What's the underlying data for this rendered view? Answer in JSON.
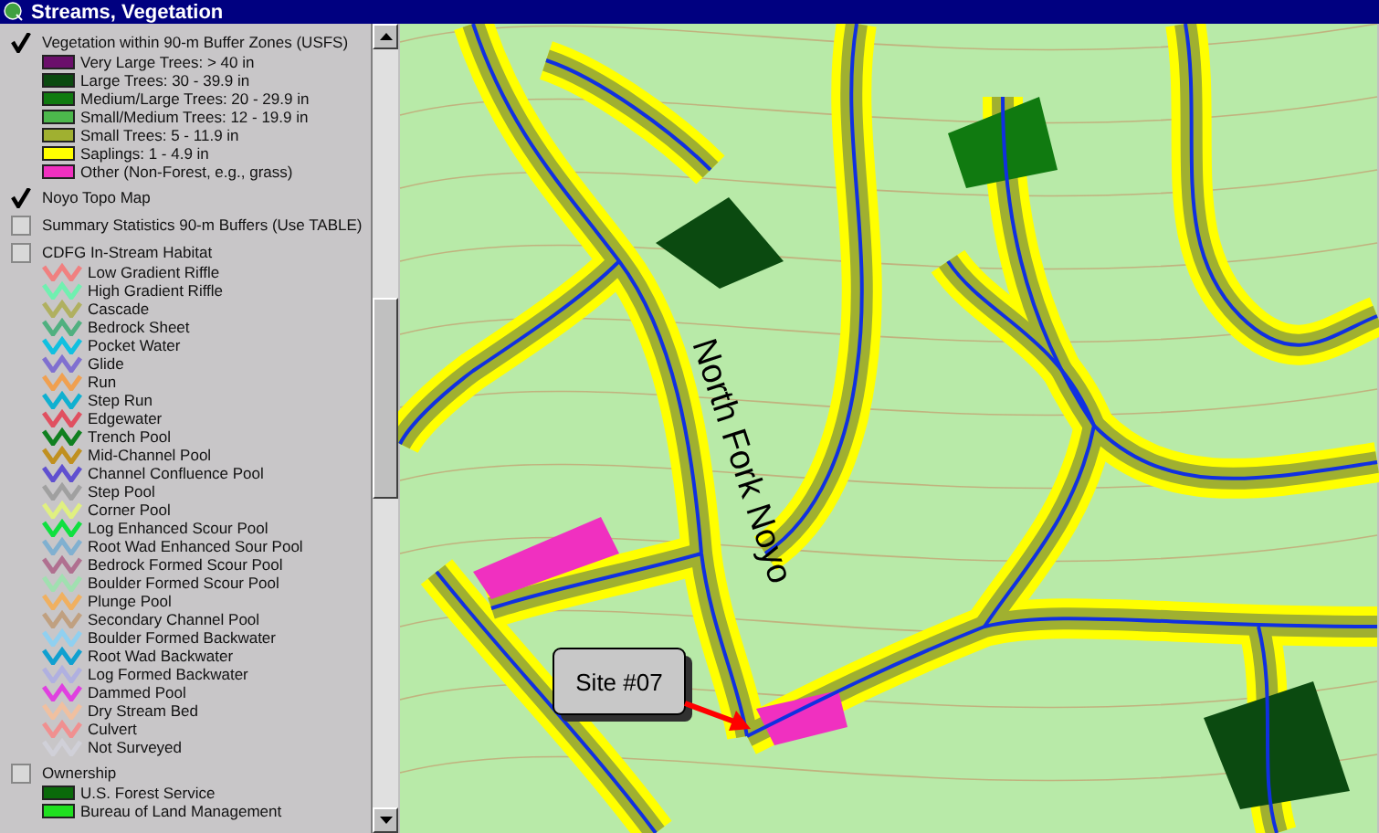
{
  "window": {
    "title": "Streams, Vegetation"
  },
  "legend": {
    "layers": [
      {
        "kind": "swatches",
        "label": "Vegetation within 90-m Buffer Zones (USFS)",
        "checked": true,
        "items": [
          {
            "label": "Very Large Trees: > 40  in",
            "color": "#6b0f6b"
          },
          {
            "label": "Large Trees: 30 - 39.9 in",
            "color": "#0b4a10"
          },
          {
            "label": "Medium/Large Trees: 20 - 29.9 in",
            "color": "#107a10"
          },
          {
            "label": "Small/Medium Trees: 12 - 19.9 in",
            "color": "#4cb84c"
          },
          {
            "label": "Small Trees: 5 - 11.9 in",
            "color": "#a0b030"
          },
          {
            "label": "Saplings: 1 - 4.9 in",
            "color": "#ffff00"
          },
          {
            "label": "Other (Non-Forest, e.g., grass)",
            "color": "#f030c0"
          }
        ]
      },
      {
        "kind": "plain",
        "label": "Noyo Topo Map",
        "checked": true
      },
      {
        "kind": "plain",
        "label": "Summary Statistics 90-m Buffers (Use TABLE)",
        "checked": false
      },
      {
        "kind": "lines",
        "label": "CDFG In-Stream Habitat",
        "checked": false,
        "items": [
          {
            "label": "Low Gradient Riffle",
            "color": "#f08080"
          },
          {
            "label": "High Gradient Riffle",
            "color": "#70f0b0"
          },
          {
            "label": "Cascade",
            "color": "#b0b060"
          },
          {
            "label": "Bedrock Sheet",
            "color": "#50b080"
          },
          {
            "label": "Pocket Water",
            "color": "#10c0e0"
          },
          {
            "label": "Glide",
            "color": "#8070d0"
          },
          {
            "label": "Run",
            "color": "#f0a050"
          },
          {
            "label": "Step Run",
            "color": "#10b0d0"
          },
          {
            "label": "Edgewater",
            "color": "#e05060"
          },
          {
            "label": "Trench Pool",
            "color": "#108020"
          },
          {
            "label": "Mid-Channel Pool",
            "color": "#c09020"
          },
          {
            "label": "Channel Confluence Pool",
            "color": "#6050d0"
          },
          {
            "label": "Step Pool",
            "color": "#a0a0a0"
          },
          {
            "label": "Corner Pool",
            "color": "#e0f080"
          },
          {
            "label": "Log Enhanced Scour Pool",
            "color": "#10e040"
          },
          {
            "label": "Root Wad Enhanced Sour Pool",
            "color": "#80b0d0"
          },
          {
            "label": "Bedrock Formed Scour Pool",
            "color": "#b07090"
          },
          {
            "label": "Boulder Formed Scour Pool",
            "color": "#a0e0b0"
          },
          {
            "label": "Plunge Pool",
            "color": "#f0b060"
          },
          {
            "label": "Secondary Channel Pool",
            "color": "#c0a080"
          },
          {
            "label": "Boulder Formed Backwater",
            "color": "#90d0f0"
          },
          {
            "label": "Root Wad Backwater",
            "color": "#10a0d0"
          },
          {
            "label": "Log Formed Backwater",
            "color": "#b0b0e0"
          },
          {
            "label": "Dammed Pool",
            "color": "#e040e0"
          },
          {
            "label": "Dry Stream Bed",
            "color": "#f0c0a0"
          },
          {
            "label": "Culvert",
            "color": "#f09090"
          },
          {
            "label": "Not Surveyed",
            "color": "#d0d0d8"
          }
        ]
      },
      {
        "kind": "swatches",
        "label": "Ownership",
        "checked": false,
        "items": [
          {
            "label": "U.S. Forest Service",
            "color": "#0a6a0a"
          },
          {
            "label": "Bureau of Land Management",
            "color": "#20e020"
          }
        ]
      }
    ]
  },
  "map": {
    "stream_label": "North Fork Noyo",
    "callout": "Site #07"
  }
}
